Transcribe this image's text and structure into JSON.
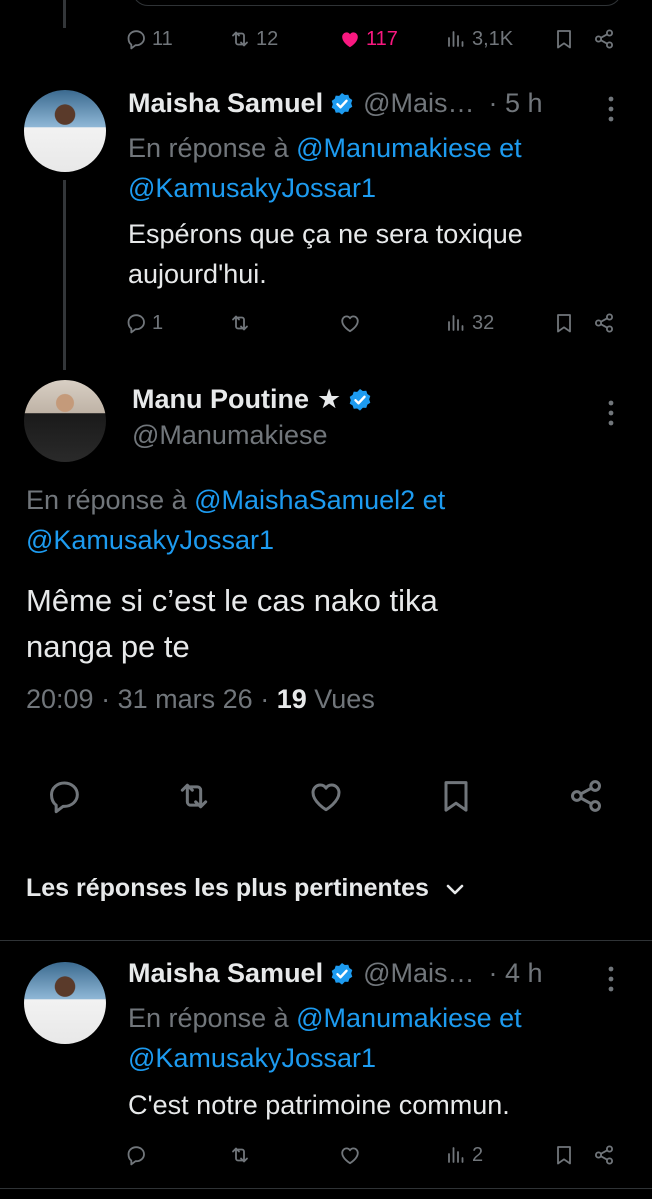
{
  "top_actions": {
    "replies": "11",
    "reposts": "12",
    "likes": "117",
    "views": "3,1K"
  },
  "reply1": {
    "name": "Maisha Samuel",
    "handle": "@Mais…",
    "time": "· 5 h",
    "reply_prefix": "En réponse à",
    "mention1": "@Manumakiese",
    "and": "et",
    "mention2": "@KamusakyJossar1",
    "text_line1": "Espérons que ça ne sera toxique",
    "text_line2": "aujourd'hui.",
    "replies": "1",
    "views": "32"
  },
  "main": {
    "name": "Manu Poutine",
    "star": "★",
    "handle": "@Manumakiese",
    "reply_prefix": "En réponse à",
    "mention1": "@MaishaSamuel2",
    "and": "et",
    "mention2": "@KamusakyJossar1",
    "text_line1": "Même si c’est le cas nako tika",
    "text_line2": "nanga pe te",
    "time": "20:09",
    "date": "31 mars 26",
    "views_count": "19",
    "views_label": "Vues"
  },
  "sort": {
    "label": "Les réponses les plus pertinentes"
  },
  "reply2": {
    "name": "Maisha Samuel",
    "handle": "@Mais…",
    "time": "· 4 h",
    "reply_prefix": "En réponse à",
    "mention1": "@Manumakiese",
    "and": "et",
    "mention2": "@KamusakyJossar1",
    "text_line1": "C'est notre patrimoine commun.",
    "views": "2"
  },
  "colors": {
    "background": "#000000",
    "text": "#e7e9ea",
    "muted": "#71767b",
    "accent": "#1d9bf0",
    "like": "#f91880"
  },
  "icons": [
    "reply-icon",
    "repost-icon",
    "like-icon",
    "views-icon",
    "bookmark-icon",
    "share-icon",
    "verified-badge-icon",
    "more-icon",
    "chevron-down-icon"
  ]
}
